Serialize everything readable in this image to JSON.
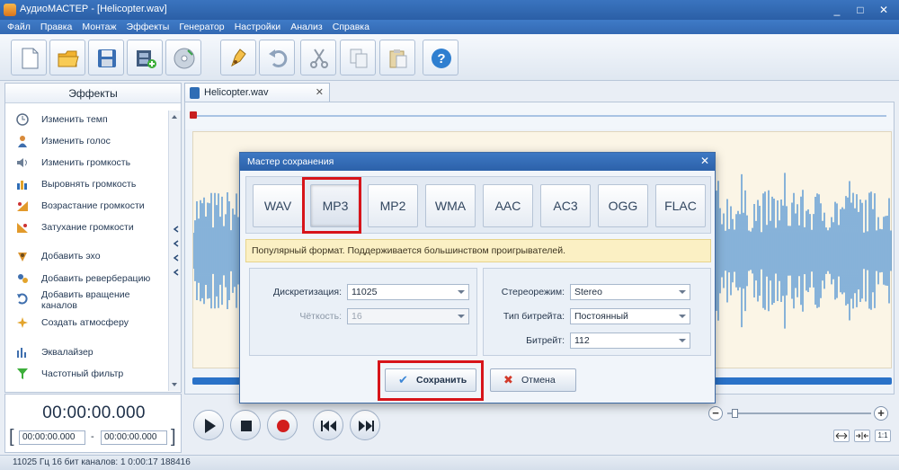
{
  "window": {
    "title": "АудиоМАСТЕР - [Helicopter.wav]",
    "minimize": "_",
    "maximize": "□",
    "close": "✕"
  },
  "menu": [
    "Файл",
    "Правка",
    "Монтаж",
    "Эффекты",
    "Генератор",
    "Настройки",
    "Анализ",
    "Справка"
  ],
  "toolbar": {
    "icons": [
      "new-file-icon",
      "open-folder-icon",
      "save-disk-icon",
      "add-video-icon",
      "cd-icon",
      "edit-tool-icon",
      "undo-icon",
      "cut-icon",
      "copy-icon",
      "paste-icon",
      "help-icon"
    ],
    "help_glyph": "?"
  },
  "effects_panel": {
    "title": "Эффекты",
    "items": [
      {
        "label": "Изменить темп",
        "icon": "clock-icon"
      },
      {
        "label": "Изменить голос",
        "icon": "person-icon"
      },
      {
        "label": "Изменить громкость",
        "icon": "volume-icon"
      },
      {
        "label": "Выровнять громкость",
        "icon": "level-icon"
      },
      {
        "label": "Возрастание громкости",
        "icon": "fade-in-icon"
      },
      {
        "label": "Затухание громкости",
        "icon": "fade-out-icon"
      },
      {
        "label": "Добавить эхо",
        "icon": "echo-icon"
      },
      {
        "label": "Добавить реверберацию",
        "icon": "reverb-icon"
      },
      {
        "label": "Добавить вращение",
        "label2": "каналов",
        "icon": "rotate-icon"
      },
      {
        "label": "Создать атмосферу",
        "icon": "atmosphere-icon"
      },
      {
        "label": "Эквалайзер",
        "icon": "equalizer-icon"
      },
      {
        "label": "Частотный фильтр",
        "icon": "filter-icon"
      }
    ]
  },
  "time_panel": {
    "current": "00:00:00.000",
    "start": "00:00:00.000",
    "separator": "-",
    "end": "00:00:00.000",
    "bracket_left": "[",
    "bracket_right": "]"
  },
  "tab": {
    "label": "Helicopter.wav",
    "close": "✕"
  },
  "dialog": {
    "title": "Мастер сохранения",
    "close": "✕",
    "formats": [
      "WAV",
      "MP3",
      "MP2",
      "WMA",
      "AAC",
      "AC3",
      "OGG",
      "FLAC"
    ],
    "selected_format": "MP3",
    "info": "Популярный формат. Поддерживается большинством проигрывателей.",
    "fields": {
      "sample_rate_label": "Дискретизация:",
      "sample_rate_value": "11025",
      "quality_label": "Чёткость:",
      "quality_value": "16",
      "stereo_label": "Стереорежим:",
      "stereo_value": "Stereo",
      "bitrate_type_label": "Тип битрейта:",
      "bitrate_type_value": "Постоянный",
      "bitrate_label": "Битрейт:",
      "bitrate_value": "112"
    },
    "save_label": "Сохранить",
    "cancel_label": "Отмена",
    "save_icon": "✔",
    "cancel_icon": "✖"
  },
  "zoom": {
    "minus": "−",
    "plus": "+",
    "fit_label": "1:1"
  },
  "status": "11025 Гц  16 бит  каналов: 1    0:00:17 188416",
  "colors": {
    "accent": "#2b5fa6",
    "highlight": "#d7141a",
    "wave": "#3a86d0",
    "wave_bg": "#fbf5e6"
  }
}
